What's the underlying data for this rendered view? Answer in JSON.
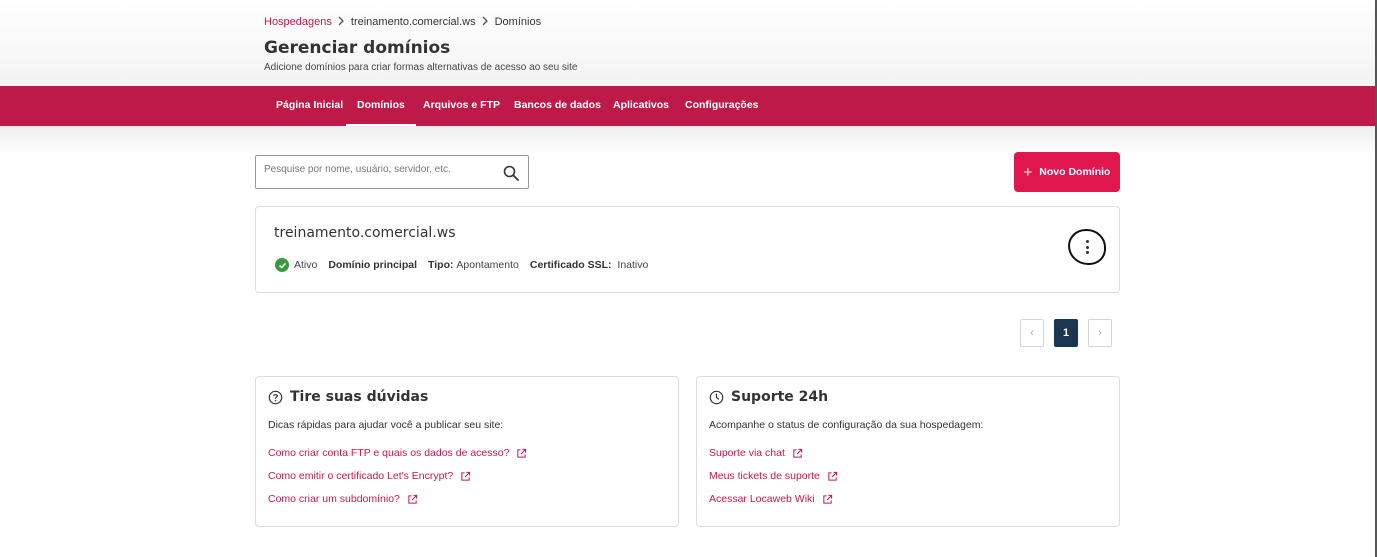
{
  "breadcrumb": {
    "root": "Hospedagens",
    "site": "treinamento.comercial.ws",
    "current": "Domínios"
  },
  "header": {
    "title": "Gerenciar domínios",
    "subtitle": "Adicione domínios para criar formas alternativas de acesso ao seu site"
  },
  "nav": {
    "items": [
      {
        "label": "Página Inicial"
      },
      {
        "label": "Domínios"
      },
      {
        "label": "Arquivos e FTP"
      },
      {
        "label": "Bancos de dados"
      },
      {
        "label": "Aplicativos"
      },
      {
        "label": "Configurações"
      }
    ],
    "active": "Domínios"
  },
  "search": {
    "placeholder": "Pesquise por nome, usuário, servidor, etc.",
    "value": ""
  },
  "actions": {
    "new_domain_label": "Novo Domínio"
  },
  "domain": {
    "name": "treinamento.comercial.ws",
    "status": "Ativo",
    "primary_label": "Domínio principal",
    "type_label": "Tipo:",
    "type_value": "Apontamento",
    "ssl_label": "Certificado SSL:",
    "ssl_value": "Inativo"
  },
  "pagination": {
    "current_page": "1",
    "prev_symbol": "‹",
    "next_symbol": "›"
  },
  "help_card": {
    "title": "Tire suas dúvidas",
    "description": "Dicas rápidas para ajudar você a publicar seu site:",
    "links": [
      {
        "label": "Como criar conta FTP e quais os dados de acesso?"
      },
      {
        "label": "Como emitir o certificado Let's Encrypt?"
      },
      {
        "label": "Como criar um subdomínio?"
      }
    ]
  },
  "support_card": {
    "title": "Suporte 24h",
    "description": "Acompanhe o status de configuração da sua hospedagem:",
    "links": [
      {
        "label": "Suporte via chat"
      },
      {
        "label": "Meus tickets de suporte"
      },
      {
        "label": "Acessar Locaweb Wiki"
      }
    ]
  },
  "colors": {
    "brand": "#bd1a47",
    "button": "#e0164f",
    "link": "#c8174a",
    "success": "#3a9b3e",
    "pagination_active": "#1b3650"
  },
  "icons": [
    "chevron-right-icon",
    "search-icon",
    "plus-icon",
    "check-circle-icon",
    "kebab-menu-icon",
    "chevron-left-icon",
    "help-circle-icon",
    "clock-icon",
    "external-link-icon"
  ]
}
